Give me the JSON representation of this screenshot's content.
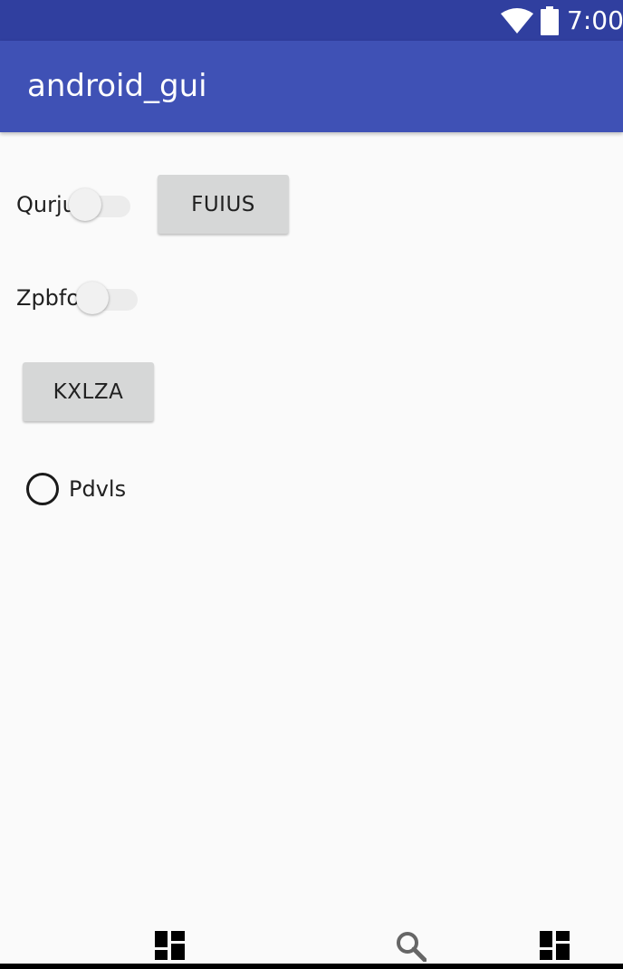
{
  "status_bar": {
    "time": "7:00",
    "icons": [
      "wifi-icon",
      "battery-icon"
    ]
  },
  "app_bar": {
    "title": "android_gui"
  },
  "form": {
    "switch1": {
      "label": "Qurju",
      "checked": false
    },
    "button1": {
      "label": "FUIUS"
    },
    "switch2": {
      "label": "Zpbfo",
      "checked": false
    },
    "button2": {
      "label": "KXLZA"
    },
    "radio1": {
      "label": "Pdvls",
      "checked": false
    }
  },
  "nav_bar": {
    "icons": [
      "dashboard-icon",
      "search-icon",
      "dashboard-icon"
    ]
  },
  "colors": {
    "status_bar": "#303f9f",
    "app_bar": "#3f51b5",
    "background": "#fafafa",
    "button": "#d6d7d7"
  }
}
